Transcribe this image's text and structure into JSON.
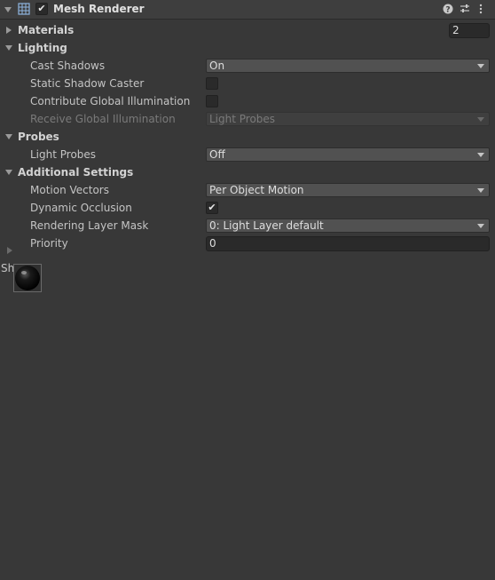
{
  "component": {
    "title": "Mesh Renderer",
    "enabled": true,
    "icon": "mesh-renderer-icon",
    "header_icons": [
      "help-icon",
      "presets-icon",
      "more-icon"
    ]
  },
  "materials": {
    "label": "Materials",
    "count": "2"
  },
  "lighting": {
    "label": "Lighting",
    "cast_shadows": {
      "label": "Cast Shadows",
      "value": "On"
    },
    "static_shadow_caster": {
      "label": "Static Shadow Caster",
      "checked": false
    },
    "contribute_gi": {
      "label": "Contribute Global Illumination",
      "checked": false
    },
    "receive_gi": {
      "label": "Receive Global Illumination",
      "value": "Light Probes"
    }
  },
  "probes": {
    "label": "Probes",
    "light_probes": {
      "label": "Light Probes",
      "value": "Off"
    }
  },
  "additional": {
    "label": "Additional Settings",
    "motion_vectors": {
      "label": "Motion Vectors",
      "value": "Per Object Motion"
    },
    "dynamic_occlusion": {
      "label": "Dynamic Occlusion",
      "checked": true,
      "check_glyph": "✔"
    },
    "rendering_layer_mask": {
      "label": "Rendering Layer Mask",
      "value": "0: Light Layer default"
    },
    "priority": {
      "label": "Priority",
      "value": "0"
    }
  },
  "material_preview": {
    "label": "Sh"
  }
}
